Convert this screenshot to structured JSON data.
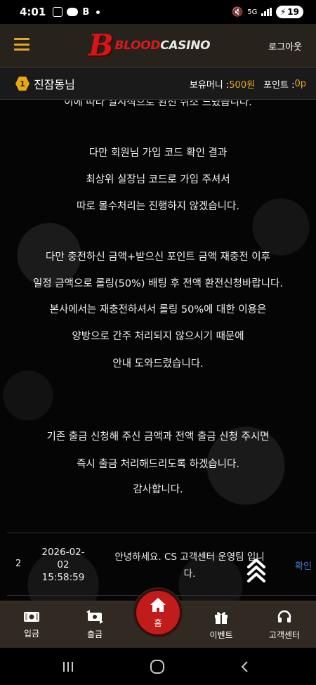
{
  "status_bar": {
    "time": "4:01",
    "app_b": "B",
    "network": "5G",
    "battery": "19"
  },
  "header": {
    "logo_letter": "B",
    "logo_word_1": "BLOOD",
    "logo_word_2": "CASINO",
    "logout_label": "로그아웃"
  },
  "user": {
    "level": "1",
    "name": "진잠동님",
    "money_label": "보유머니 : ",
    "money_value": "500원",
    "point_label": "포인트 : ",
    "point_value": "0p"
  },
  "message_lines": [
    "이에 따라 일시적으로 환전 취소 드렸습니다.",
    "다만 회원님 가입 코드 확인 결과",
    "최상위 실장님 코드로 가입 주셔서",
    "따로 몰수처리는 진행하지 않겠습니다.",
    "다만 충전하신 금액+받으신 포인트 금액 재충전 이후",
    "일정 금액으로 롤링(50%) 배팅 후 전액 환전신청바랍니다.",
    "본사에서는 재충전하셔서 롤링 50%에 대한 이용은",
    "양방으로 간주 처리되지 않으시기 때문에",
    "안내 도와드렸습니다.",
    "기존 출금 신청해 주신 금액과 전액 출금 신청 주시면",
    "즉시 출금 처리해드리도록 하겠습니다.",
    "감사합니다."
  ],
  "row": {
    "number": "2",
    "date_line1": "2026-02-",
    "date_line2": "02",
    "time": "15:58:59",
    "title_line1": "안녕하세요. CS 고객센터 운영팀 입니",
    "title_line2": "다.",
    "status": "확인"
  },
  "bottom_nav": {
    "deposit": "입금",
    "withdraw": "출금",
    "home": "홈",
    "event": "이벤트",
    "support": "고객센터"
  },
  "colors": {
    "accent_gold": "#e6a817",
    "brand_red": "#c01c1c",
    "link_blue": "#3f7fd4"
  }
}
